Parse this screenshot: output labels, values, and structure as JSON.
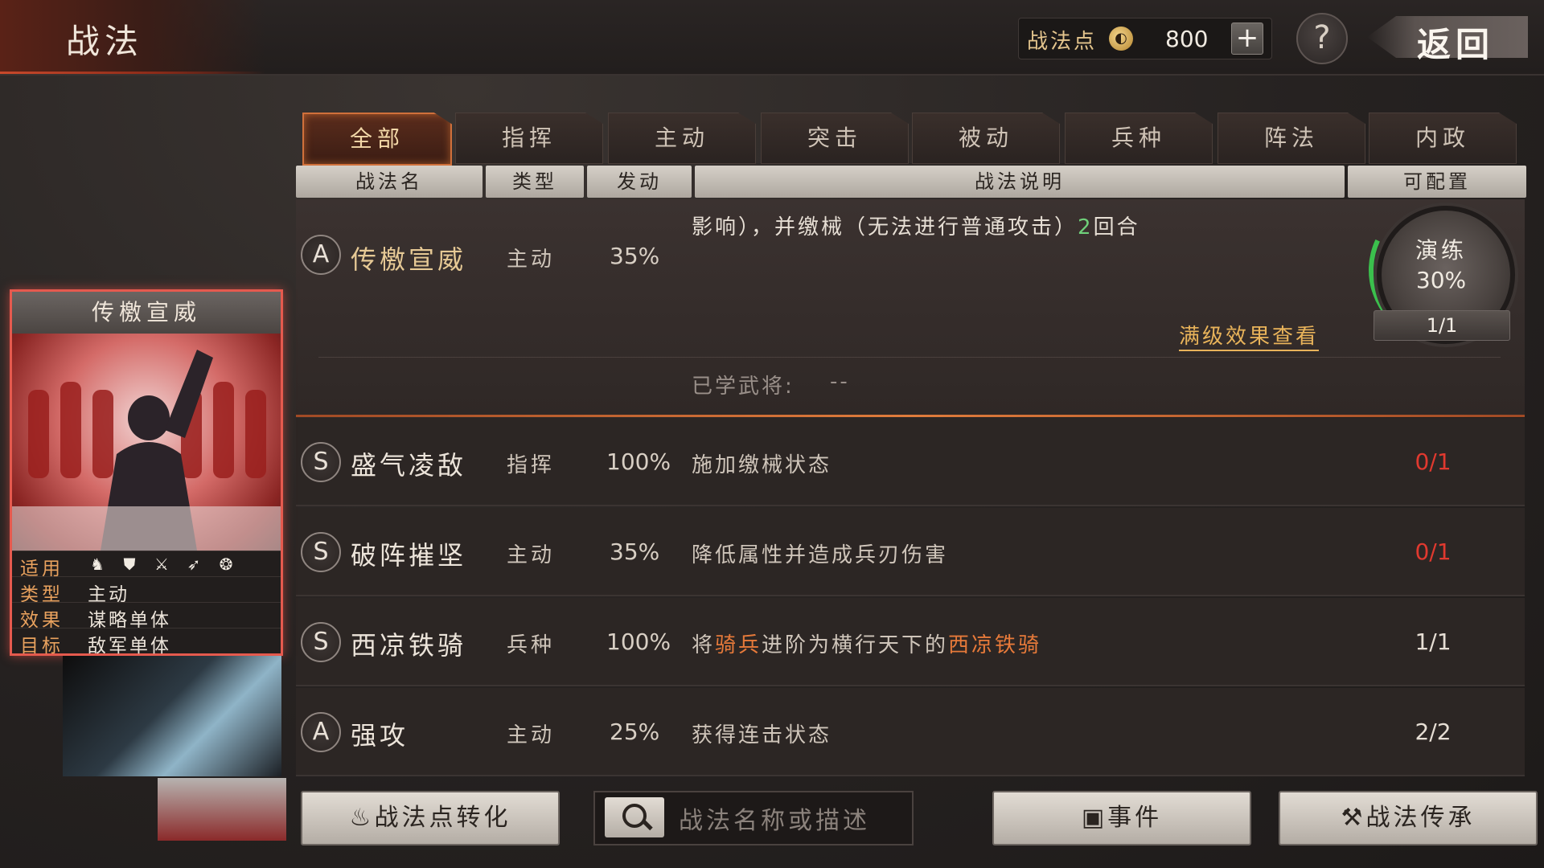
{
  "header": {
    "title": "战法",
    "points_label": "战法点",
    "points_value": "800",
    "add_label": "+",
    "help_label": "?",
    "back_label": "返回"
  },
  "tabs": [
    "全部",
    "指挥",
    "主动",
    "突击",
    "被动",
    "兵种",
    "阵法",
    "内政"
  ],
  "active_tab": "全部",
  "table_headers": {
    "name": "战法名",
    "type": "类型",
    "rate": "发动",
    "desc": "战法说明",
    "config": "可配置"
  },
  "expanded": {
    "grade": "A",
    "name": "传檄宣威",
    "type": "主动",
    "rate": "35%",
    "desc_a": "影响），并缴械（无法进行普通攻击）",
    "desc_num": "2",
    "desc_b": "回合",
    "max_effect_link": "满级效果查看",
    "learned_label": "已学武将:",
    "learned_value": "--",
    "train_label": "演练",
    "train_pct": "30%",
    "train_count": "1/1"
  },
  "rows": [
    {
      "grade": "S",
      "name": "盛气凌敌",
      "type": "指挥",
      "rate": "100%",
      "desc": "施加缴械状态",
      "count": "0/1"
    },
    {
      "grade": "S",
      "name": "破阵摧坚",
      "type": "主动",
      "rate": "35%",
      "desc": "降低属性并造成兵刃伤害",
      "count": "0/1"
    },
    {
      "grade": "S",
      "name": "西凉铁骑",
      "type": "兵种",
      "rate": "100%",
      "desc_a": "将",
      "desc_hl1": "骑兵",
      "desc_b": "进阶为横行天下的",
      "desc_hl2": "西凉铁骑",
      "count": "1/1"
    },
    {
      "grade": "A",
      "name": "强攻",
      "type": "主动",
      "rate": "25%",
      "desc": "获得连击状态",
      "count": "2/2"
    }
  ],
  "card": {
    "title": "传檄宣威",
    "apply_key": "适用",
    "type_key": "类型",
    "type_val": "主动",
    "effect_key": "效果",
    "effect_val": "谋略单体",
    "target_key": "目标",
    "target_val": "敌军单体"
  },
  "bottom": {
    "convert_label": "战法点转化",
    "search_placeholder": "战法名称或描述",
    "event_label": "事件",
    "inherit_label": "战法传承"
  },
  "colors": {
    "accent_red": "#e0392f",
    "highlight_orange": "#e77a3a",
    "train_green": "#3bbf4d",
    "tab_active_border": "#d0703b"
  }
}
